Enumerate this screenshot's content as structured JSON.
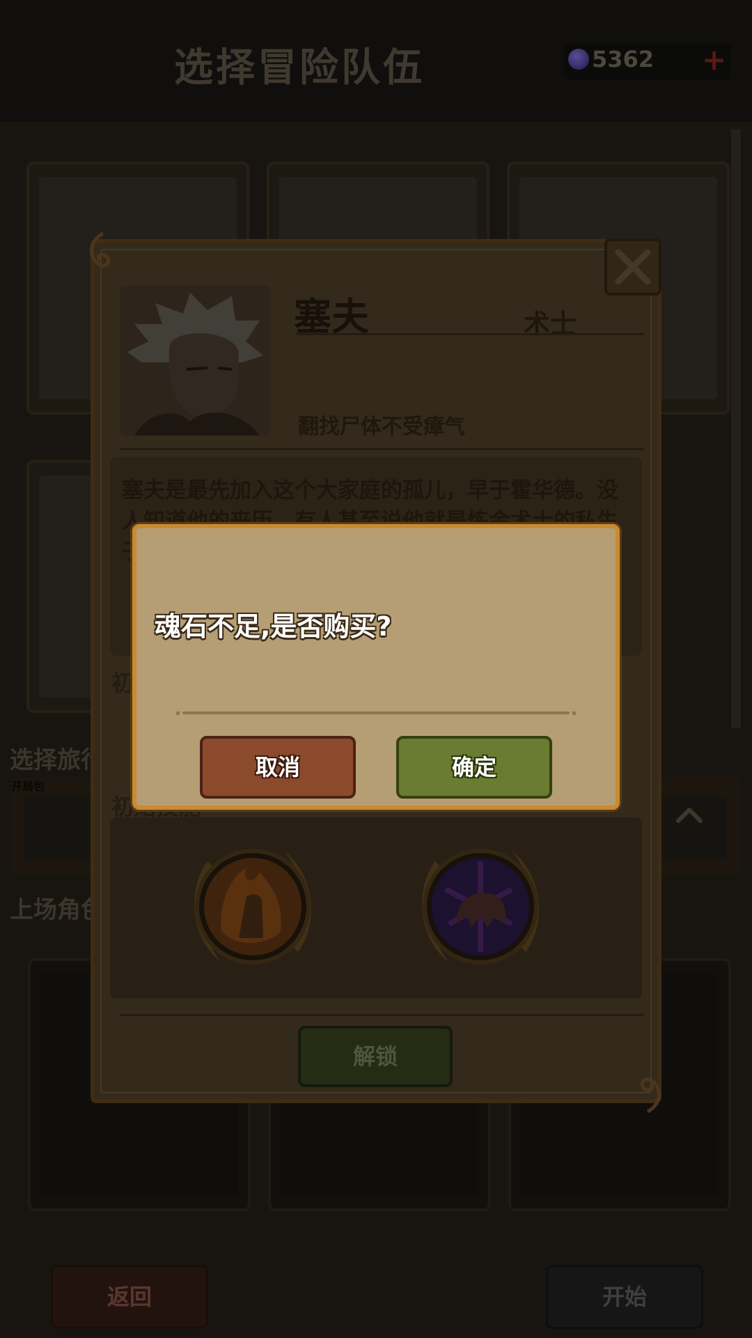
{
  "screen": {
    "title": "选择冒险队伍",
    "currency": {
      "icon": "soul-stone-icon",
      "amount": "5362"
    },
    "labels": {
      "companion_select": "选择旅行",
      "background_option": "开局包",
      "deployed": "上场角色"
    },
    "back_label": "返回",
    "start_label": "开始"
  },
  "hero_panel": {
    "name": "塞夫",
    "class": "术士",
    "trait": "翻找尸体不受瘴气",
    "description": "塞夫是最先加入这个大家庭的孤儿，早于霍华德。没人知道他的来历，有人甚至说他就是炼金术士的私生子……",
    "skills_label_a": "初",
    "skills_label_b": "初始技能",
    "skills": [
      {
        "icon": "fire-fist-skill-icon"
      },
      {
        "icon": "shadow-claw-skill-icon"
      }
    ],
    "unlock_label": "解锁"
  },
  "dialog": {
    "message": "魂石不足,是否购买?",
    "cancel_label": "取消",
    "confirm_label": "确定"
  },
  "colors": {
    "dialog_bg": "#b59e74",
    "dialog_border": "#c88a32",
    "cancel": "#8b4a2c",
    "confirm": "#6a7b32"
  }
}
